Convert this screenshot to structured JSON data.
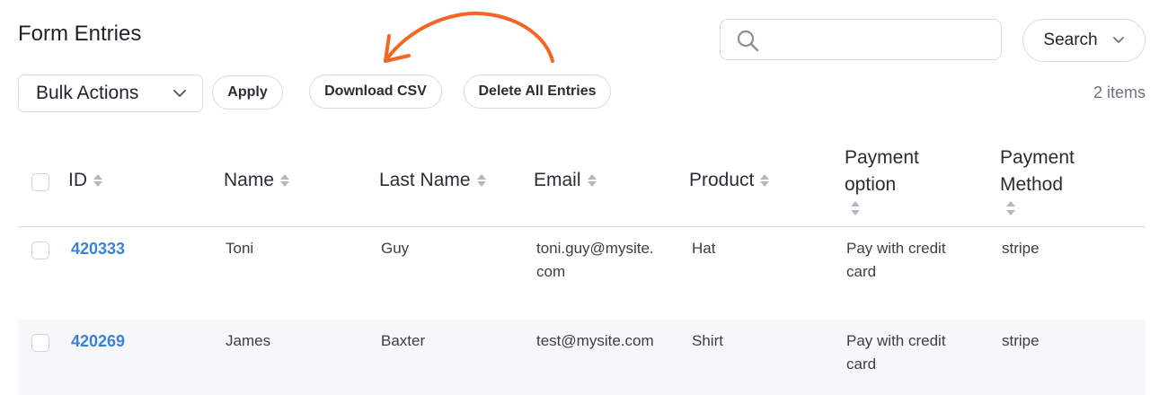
{
  "page_title": "Form Entries",
  "search": {
    "placeholder": "",
    "button_label": "Search"
  },
  "toolbar": {
    "bulk_actions": "Bulk Actions",
    "apply": "Apply",
    "download_csv": "Download CSV",
    "delete_all": "Delete All Entries",
    "item_count": "2 items"
  },
  "annotation": {
    "arrow_color": "#f26522"
  },
  "table": {
    "columns": {
      "id": "ID",
      "name": "Name",
      "last_name": "Last Name",
      "email": "Email",
      "product": "Product",
      "payment_option_1": "Payment",
      "payment_option_2": "option",
      "payment_method_1": "Payment",
      "payment_method_2": "Method"
    },
    "rows": [
      {
        "id": "420333",
        "name": "Toni",
        "last_name": "Guy",
        "email_1": "toni.guy@mysite.",
        "email_2": "com",
        "product": "Hat",
        "payment_option_1": "Pay with credit",
        "payment_option_2": "card",
        "payment_method": "stripe"
      },
      {
        "id": "420269",
        "name": "James",
        "last_name": "Baxter",
        "email_1": "test@mysite.com",
        "email_2": "",
        "product": "Shirt",
        "payment_option_1": "Pay with credit",
        "payment_option_2": "card",
        "payment_method": "stripe"
      }
    ]
  },
  "colors": {
    "link": "#3b82d6",
    "border": "#d7dbe0",
    "alt_row": "#f6f7f8"
  }
}
